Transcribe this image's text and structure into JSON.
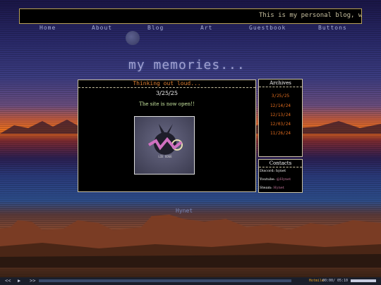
{
  "marquee": {
    "text": "This is my personal blog, where I w"
  },
  "nav": [
    {
      "label": "Home"
    },
    {
      "label": "About"
    },
    {
      "label": "Blog"
    },
    {
      "label": "Art"
    },
    {
      "label": "Guestbook"
    },
    {
      "label": "Buttons"
    }
  ],
  "site_title": "my memories...",
  "post": {
    "header": "Thinking out loud...",
    "date": "3/25/25",
    "text": "The site is now open!!",
    "image_caption": "LIE EDGE"
  },
  "archives": {
    "title": "Archives",
    "items": [
      "3/25/25",
      "12/14/24",
      "12/13/24",
      "12/03/24",
      "11/26/24"
    ]
  },
  "contacts": {
    "title": "Contacts",
    "rows": [
      {
        "label": "Discord:",
        "value": "hynet"
      },
      {
        "label": "Youtube:",
        "value": "@Hynet"
      },
      {
        "label": "Steam:",
        "value": "Hynet"
      }
    ]
  },
  "signature": "Hynet",
  "player": {
    "prev": "<<",
    "play": "▶",
    "next": ">>",
    "song": "Hotmile",
    "elapsed": "00:00",
    "duration": "05:10"
  },
  "colors": {
    "accent_orange": "#e87020",
    "border": "#c8c0a0",
    "link_pink": "#c87aa0"
  }
}
